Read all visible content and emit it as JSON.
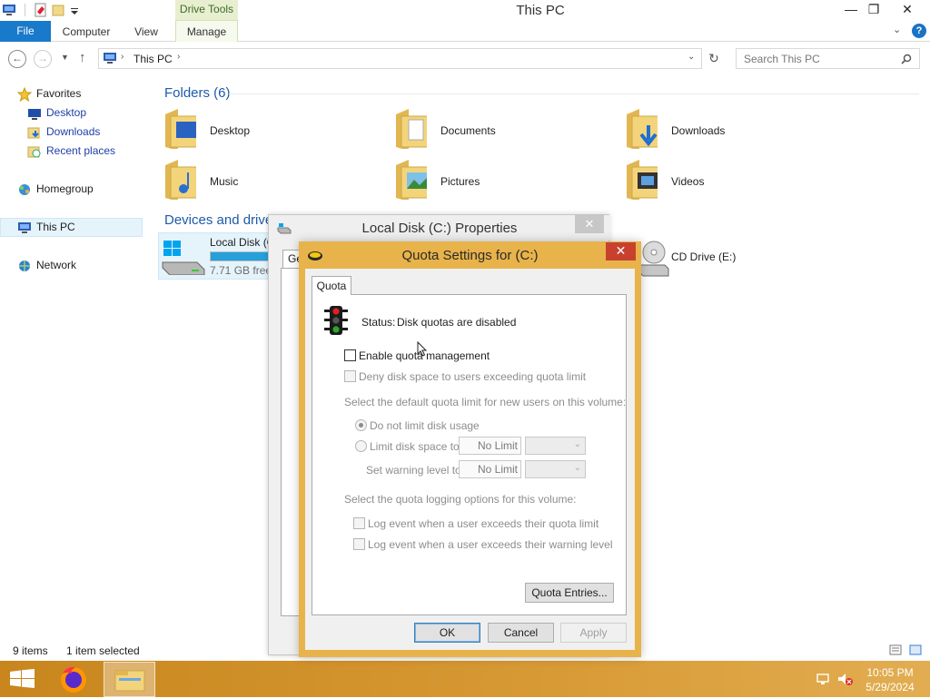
{
  "window": {
    "title": "This PC",
    "context_tab": "Drive Tools"
  },
  "ribbon": {
    "tabs": [
      "File",
      "Computer",
      "View",
      "Manage"
    ]
  },
  "address": {
    "crumb": "This PC",
    "search_placeholder": "Search This PC"
  },
  "nav": {
    "favorites": "Favorites",
    "favorites_items": [
      "Desktop",
      "Downloads",
      "Recent places"
    ],
    "homegroup": "Homegroup",
    "thispc": "This PC",
    "network": "Network"
  },
  "main": {
    "folders_header": "Folders (6)",
    "folders": [
      "Desktop",
      "Documents",
      "Downloads",
      "Music",
      "Pictures",
      "Videos"
    ],
    "devices_header": "Devices and drives",
    "local_disk": {
      "name": "Local Disk (C:)",
      "free": "7.71 GB free",
      "fill": 0.82
    },
    "cd_drive": "CD Drive (E:)"
  },
  "status": {
    "items": "9 items",
    "selected": "1 item selected"
  },
  "props_dialog": {
    "title": "Local Disk (C:) Properties",
    "tab_fragment": "Ge"
  },
  "quota": {
    "title": "Quota Settings for  (C:)",
    "tab": "Quota",
    "status_label": "Status:",
    "status": "Disk quotas are disabled",
    "enable": "Enable quota management",
    "deny": "Deny disk space to users exceeding quota limit",
    "default_limit_caption": "Select the default quota limit for new users on this volume:",
    "no_limit": "Do not limit disk usage",
    "limit_space": "Limit disk space to",
    "warning_level": "Set warning level to",
    "limit_value": "No Limit",
    "warning_value": "No Limit",
    "logging_caption": "Select the quota logging options for this volume:",
    "log_quota": "Log event when a user exceeds their quota limit",
    "log_warning": "Log event when a user exceeds their warning level",
    "entries_btn": "Quota Entries...",
    "ok": "OK",
    "cancel": "Cancel",
    "apply": "Apply"
  },
  "taskbar": {
    "time": "10:05 PM",
    "date": "5/29/2024"
  },
  "colors": {
    "accent": "#1979ca",
    "taskbar": "#d89a35",
    "dialog_frame": "#e8b34a",
    "close_red": "#c8412e"
  }
}
